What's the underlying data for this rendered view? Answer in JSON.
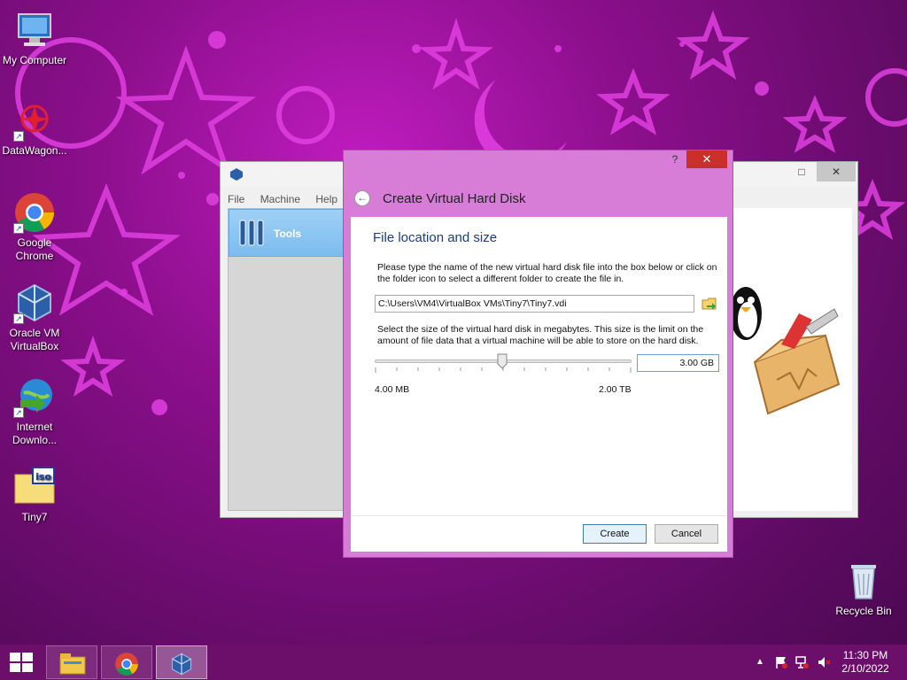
{
  "desktop": {
    "icons": [
      {
        "label": "My Computer",
        "icon": "computer-icon"
      },
      {
        "label": "DataWagon...",
        "icon": "datawagon-icon"
      },
      {
        "label": "Google Chrome",
        "icon": "chrome-icon"
      },
      {
        "label": "Oracle VM VirtualBox",
        "icon": "virtualbox-icon"
      },
      {
        "label": "Internet Downlo...",
        "icon": "internet-download-manager-icon"
      },
      {
        "label": "Tiny7",
        "icon": "iso-file-icon"
      },
      {
        "label": "Recycle Bin",
        "icon": "recycle-bin-icon"
      }
    ]
  },
  "vbox_manager": {
    "menu": [
      "File",
      "Machine",
      "Help"
    ],
    "tools_label": "Tools"
  },
  "dialog": {
    "help": "?",
    "close": "✕",
    "title": "Create Virtual Hard Disk",
    "section_title": "File location and size",
    "description1": "Please type the name of the new virtual hard disk file into the box below or click on the folder icon to select a different folder to create the file in.",
    "file_path": "C:\\Users\\VM4\\VirtualBox VMs\\Tiny7\\Tiny7.vdi",
    "description2": "Select the size of the virtual hard disk in megabytes. This size is the limit on the amount of file data that a virtual machine will be able to store on the hard disk.",
    "size_value": "3.00 GB",
    "slider_min_label": "4.00 MB",
    "slider_max_label": "2.00 TB",
    "create_label": "Create",
    "cancel_label": "Cancel"
  },
  "taskbar": {
    "time": "11:30 PM",
    "date": "2/10/2022",
    "pinned": [
      "file-explorer-icon",
      "chrome-icon",
      "virtualbox-icon"
    ]
  },
  "colors": {
    "desktop_bg": "#8c0f8c",
    "taskbar": "#6b0f6b",
    "dialog_frame": "#d77dd7",
    "close_button": "#c9302c",
    "accent_text": "#1d3f77"
  }
}
